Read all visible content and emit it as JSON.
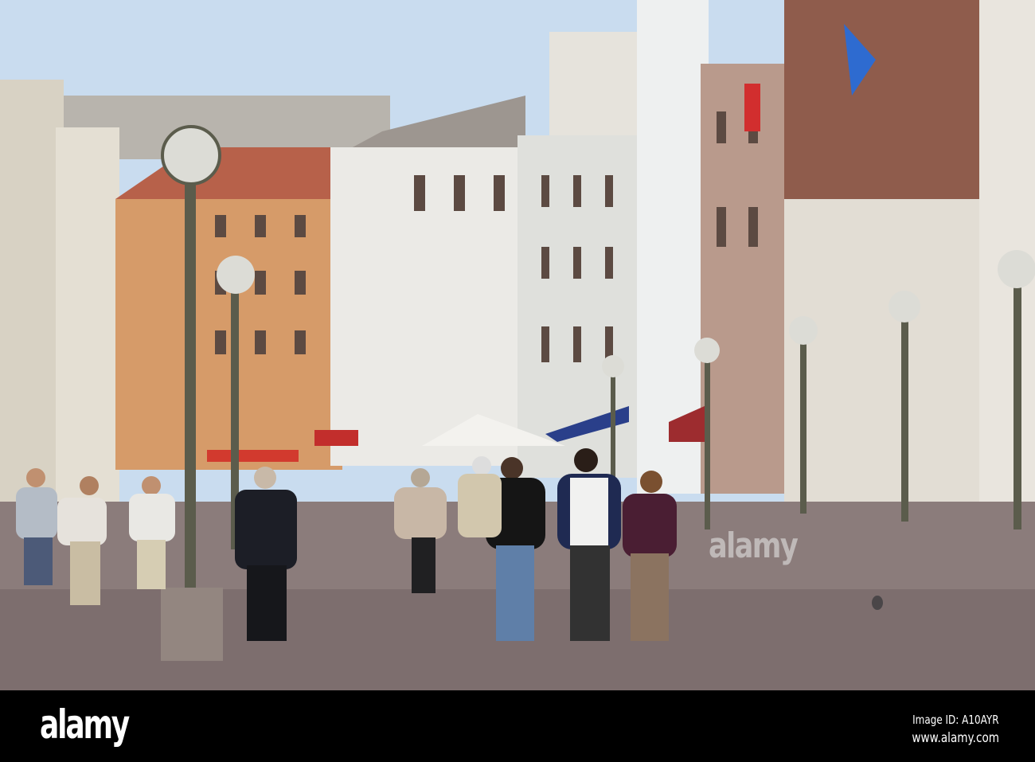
{
  "photo": {
    "subject": "Pedestrian street with lamp posts and pedestrians",
    "watermark": "alamy"
  },
  "footer": {
    "logo": "alamy",
    "image_id": "Image ID: A10AYR",
    "website": "www.alamy.com"
  },
  "colors": {
    "sky": "#c9dcef",
    "pavement": "#8b7c7b",
    "orange_building": "#d69b69",
    "footer": "#000000"
  }
}
